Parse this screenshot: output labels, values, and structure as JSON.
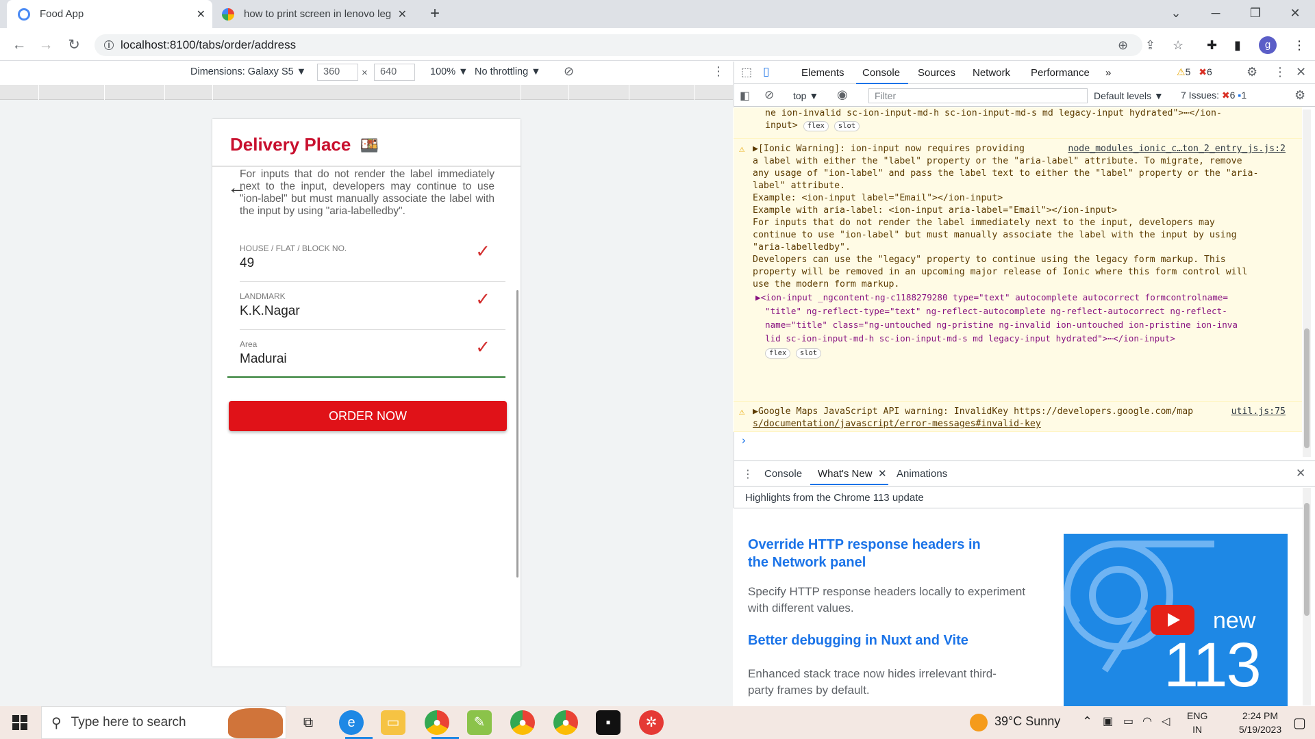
{
  "browser": {
    "tabs": [
      {
        "title": "Food App",
        "close": "✕"
      },
      {
        "title": "how to print screen in lenovo leg",
        "close": "✕"
      }
    ],
    "new_tab": "+",
    "address": "localhost:8100/tabs/order/address",
    "profile_initial": "g",
    "window_controls": {
      "minimize": "─",
      "restore": "❐",
      "close": "✕",
      "tabsearch": "⌄"
    }
  },
  "device_toolbar": {
    "dimensions": "Dimensions: Galaxy S5 ▼",
    "width": "360",
    "times": "×",
    "height": "640",
    "zoom": "100% ▼",
    "throttle": "No throttling ▼"
  },
  "app": {
    "title": "Delivery Place",
    "notice": "For inputs that do not render the label immediately next to the input, developers may continue to use \"ion-label\" but must manually associate the label with the input by using \"aria-labelledby\".",
    "fields": [
      {
        "label": "HOUSE / FLAT / BLOCK NO.",
        "value": "49"
      },
      {
        "label": "LANDMARK",
        "value": "K.K.Nagar"
      },
      {
        "label": "Area",
        "value": "Madurai"
      }
    ],
    "order_button": "ORDER NOW"
  },
  "devtools": {
    "tabs": [
      "Elements",
      "Console",
      "Sources",
      "Network",
      "Performance",
      "»"
    ],
    "warnings_count": "5",
    "errors_count": "6",
    "context": "top ▼",
    "filter_placeholder": "Filter",
    "levels": "Default levels ▼",
    "issues_label": "7 Issues:",
    "issues_errors": "6",
    "issues_info": "1",
    "console": {
      "top_lines": [
        "ne ion-invalid sc-ion-input-md-h sc-ion-input-md-s md legacy-input hydrated\">⋯</ion-",
        "input>"
      ],
      "warn1_source": "node_modules_ionic_c…ton_2_entry_js.js:2",
      "warn1_lines": [
        "▶[Ionic Warning]: ion-input now requires providing",
        "a label with either the \"label\" property or the \"aria-label\" attribute. To migrate, remove",
        "any usage of \"ion-label\" and pass the label text to either the \"label\" property or the \"aria-",
        "label\" attribute.",
        "",
        "Example: <ion-input label=\"Email\"></ion-input>",
        "Example with aria-label: <ion-input aria-label=\"Email\"></ion-input>",
        "",
        "For inputs that do not render the label immediately next to the input, developers may",
        "continue to use \"ion-label\" but must manually associate the label with the input by using",
        "\"aria-labelledby\".",
        "",
        "Developers can use the \"legacy\" property to continue using the legacy form markup. This",
        "property will be removed in an upcoming major release of Ionic where this form control will",
        "use the modern form markup."
      ],
      "warn1_element": [
        "▶<ion-input _ngcontent-ng-c1188279280 type=\"text\" autocomplete autocorrect formcontrolname=",
        "\"title\" ng-reflect-type=\"text\" ng-reflect-autocomplete ng-reflect-autocorrect ng-reflect-",
        "name=\"title\" class=\"ng-untouched ng-pristine ng-invalid ion-untouched ion-pristine ion-inva",
        "lid sc-ion-input-md-h sc-ion-input-md-s md legacy-input hydrated\">⋯</ion-input>"
      ],
      "badge_flex": "flex",
      "badge_slot": "slot",
      "warn2_text": "▶Google Maps JavaScript API warning: InvalidKey https://developers.google.com/map",
      "warn2_text2": "s/documentation/javascript/error-messages#invalid-key",
      "warn2_source": "util.js:75",
      "prompt": "›"
    },
    "drawer": {
      "tabs": [
        "Console",
        "What's New",
        "Animations"
      ],
      "highlights": "Highlights from the Chrome 113 update",
      "items": [
        {
          "title": "Override HTTP response headers in the Network panel",
          "body": "Specify HTTP response headers locally to experiment with different values."
        },
        {
          "title": "Better debugging in Nuxt and Vite",
          "body": "Enhanced stack trace now hides irrelevant third-party frames by default."
        }
      ],
      "promo_new": "new",
      "promo_version": "113"
    }
  },
  "taskbar": {
    "search_placeholder": "Type here to search",
    "weather": "39°C  Sunny",
    "lang1": "ENG",
    "lang2": "IN",
    "time": "2:24 PM",
    "date": "5/19/2023"
  },
  "colors": {
    "accent": "#c8102e",
    "button": "#e01218",
    "check": "#d32f2f"
  }
}
